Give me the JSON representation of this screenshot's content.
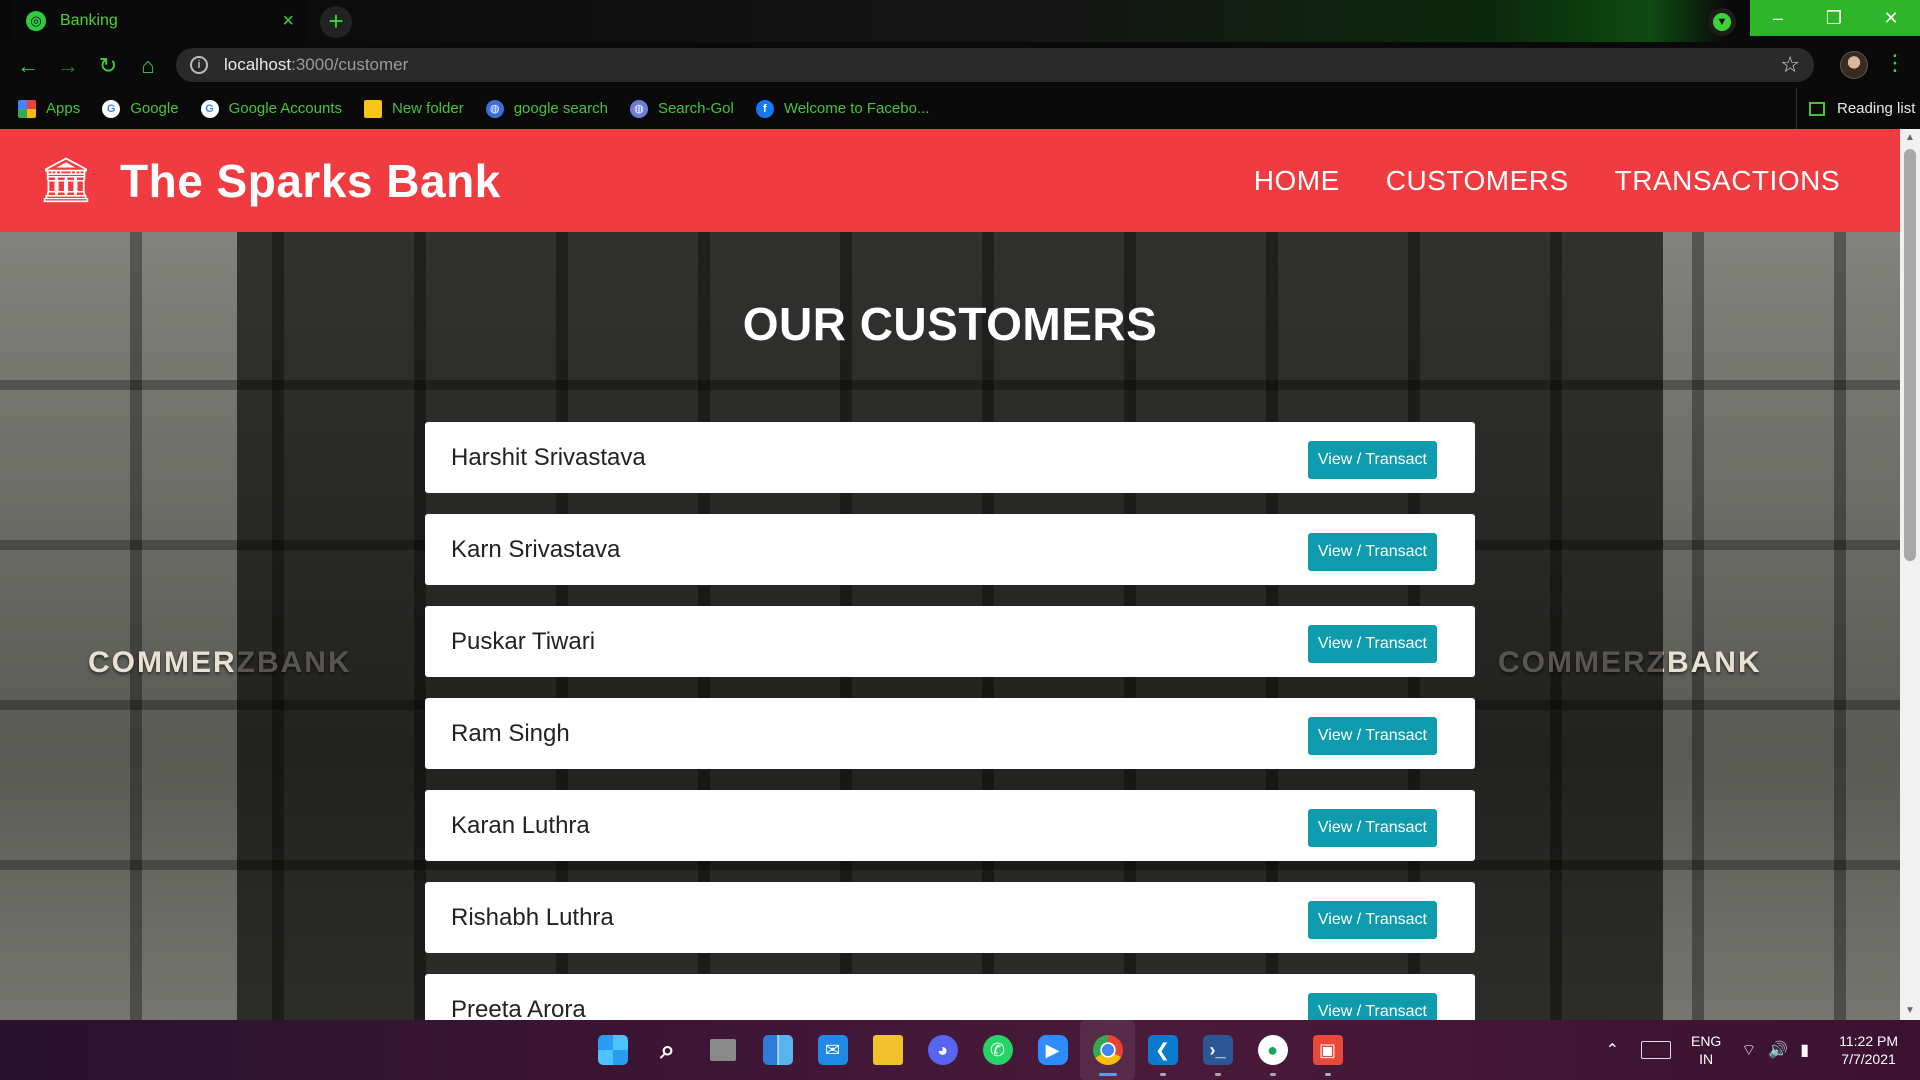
{
  "browser": {
    "tab_title": "Banking",
    "tab_close": "×",
    "new_tab": "+",
    "url_host": "localhost",
    "url_path": ":3000/customer",
    "window_controls": {
      "minimize": "–",
      "maximize": "❐",
      "close": "✕"
    },
    "bookmarks": [
      {
        "label": "Apps",
        "icon": "apps-grid-icon"
      },
      {
        "label": "Google",
        "icon": "google-icon"
      },
      {
        "label": "Google Accounts",
        "icon": "google-icon"
      },
      {
        "label": "New folder",
        "icon": "folder-icon"
      },
      {
        "label": "google search",
        "icon": "search-globe-icon"
      },
      {
        "label": "Search-Gol",
        "icon": "search-globe-icon"
      },
      {
        "label": "Welcome to Facebo...",
        "icon": "facebook-icon"
      }
    ],
    "reading_list": "Reading list"
  },
  "site": {
    "brand": "The Sparks Bank",
    "nav": [
      "HOME",
      "CUSTOMERS",
      "TRANSACTIONS"
    ],
    "heading": "OUR CUSTOMERS",
    "background_sign": "COMMERZBANK",
    "button_label": "View / Transact",
    "accent_color": "#f03c40",
    "button_color": "#0f9bae",
    "customers": [
      "Harshit Srivastava",
      "Karn Srivastava",
      "Puskar Tiwari",
      "Ram Singh",
      "Karan Luthra",
      "Rishabh Luthra",
      "Preeta Arora"
    ]
  },
  "taskbar": {
    "icons": [
      "windows-start-icon",
      "search-icon",
      "task-view-icon",
      "widgets-icon",
      "mail-icon",
      "file-explorer-icon",
      "discord-icon",
      "whatsapp-icon",
      "zoom-icon",
      "chrome-icon",
      "vscode-icon",
      "powershell-icon",
      "mongodb-icon",
      "office-icon"
    ],
    "lang_top": "ENG",
    "lang_bottom": "IN",
    "time": "11:22 PM",
    "date": "7/7/2021"
  }
}
